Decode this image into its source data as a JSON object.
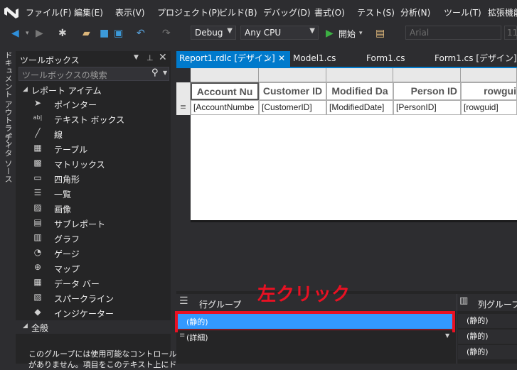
{
  "menu": [
    "ファイル(F)",
    "編集(E)",
    "表示(V)",
    "プロジェクト(P)",
    "ビルド(B)",
    "デバッグ(D)",
    "書式(O)",
    "テスト(S)",
    "分析(N)",
    "ツール(T)",
    "拡張機能"
  ],
  "toolbar": {
    "configuration": "Debug",
    "platform": "Any CPU",
    "start_label": "開始",
    "font": "Arial",
    "font_size": "11"
  },
  "side_tabs": [
    "ドキュメント アウトライン",
    "データ ソース"
  ],
  "toolbox": {
    "title": "ツールボックス",
    "search_placeholder": "ツールボックスの検索",
    "section_report_items": "レポート アイテム",
    "items": [
      {
        "label": "ポインター",
        "icon": "pointer-icon"
      },
      {
        "label": "テキスト ボックス",
        "icon": "textbox-icon"
      },
      {
        "label": "線",
        "icon": "line-icon"
      },
      {
        "label": "テーブル",
        "icon": "table-icon"
      },
      {
        "label": "マトリックス",
        "icon": "matrix-icon"
      },
      {
        "label": "四角形",
        "icon": "rectangle-icon"
      },
      {
        "label": "一覧",
        "icon": "list-icon"
      },
      {
        "label": "画像",
        "icon": "image-icon"
      },
      {
        "label": "サブレポート",
        "icon": "subreport-icon"
      },
      {
        "label": "グラフ",
        "icon": "chart-icon"
      },
      {
        "label": "ゲージ",
        "icon": "gauge-icon"
      },
      {
        "label": "マップ",
        "icon": "map-icon"
      },
      {
        "label": "データ バー",
        "icon": "databar-icon"
      },
      {
        "label": "スパークライン",
        "icon": "sparkline-icon"
      },
      {
        "label": "インジケーター",
        "icon": "indicator-icon"
      }
    ],
    "section_general": "全般",
    "general_message_line1": "このグループには使用可能なコントロール",
    "general_message_line2": "がありません。項目をこのテキスト上にド"
  },
  "doc_tabs": [
    {
      "label": "Report1.rdlc [デザイン]",
      "active": true
    },
    {
      "label": "Model1.cs",
      "active": false
    },
    {
      "label": "Form1.cs",
      "active": false
    },
    {
      "label": "Form1.cs [デザイン]",
      "active": false
    }
  ],
  "report_table": {
    "headers": [
      "Account Nu",
      "Customer ID",
      "Modified Da",
      "Person ID",
      "rowgui"
    ],
    "values": [
      "[AccountNumbe",
      "[CustomerID]",
      "[ModifiedDate]",
      "[PersonID]",
      "[rowguid]"
    ]
  },
  "grouping": {
    "row_groups_title": "行グループ",
    "col_groups_title": "列グループ",
    "row_static": "(静的)",
    "row_details": "(詳細)",
    "col_items": [
      "(静的)",
      "(静的)",
      "(静的)"
    ]
  },
  "annotation": "左クリック",
  "colors": {
    "accent": "#007acc",
    "selection": "#3399ff",
    "annotation": "#e81123"
  }
}
